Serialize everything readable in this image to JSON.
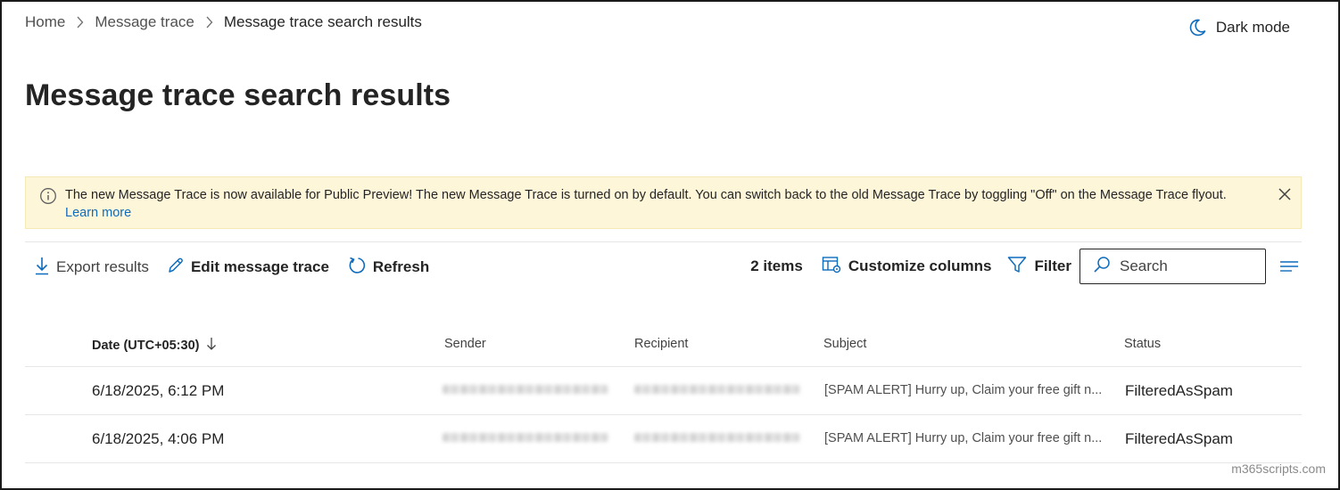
{
  "breadcrumb": {
    "home": "Home",
    "message_trace": "Message trace",
    "current": "Message trace search results"
  },
  "header": {
    "dark_mode_label": "Dark mode",
    "page_title": "Message trace search results"
  },
  "banner": {
    "message": "The new Message Trace is now available for Public Preview! The new Message Trace is turned on by default. You can switch back to the old Message Trace by toggling \"Off\" on the Message Trace flyout.",
    "link_text": "Learn more",
    "background_color": "#fdf6d9"
  },
  "toolbar": {
    "export_label": "Export results",
    "edit_label": "Edit message trace",
    "refresh_label": "Refresh",
    "items_count": "2 items",
    "customize_label": "Customize columns",
    "filter_label": "Filter",
    "search_placeholder": "Search"
  },
  "table": {
    "columns": {
      "date": "Date (UTC+05:30)",
      "sender": "Sender",
      "recipient": "Recipient",
      "subject": "Subject",
      "status": "Status"
    },
    "rows": [
      {
        "date": "6/18/2025, 6:12 PM",
        "subject": "[SPAM ALERT] Hurry up, Claim your free gift n...",
        "status": "FilteredAsSpam"
      },
      {
        "date": "6/18/2025, 4:06 PM",
        "subject": "[SPAM ALERT] Hurry up, Claim your free gift n...",
        "status": "FilteredAsSpam"
      }
    ]
  },
  "watermark": "m365scripts.com",
  "colors": {
    "accent": "#0f6cbd",
    "text": "#242424"
  }
}
